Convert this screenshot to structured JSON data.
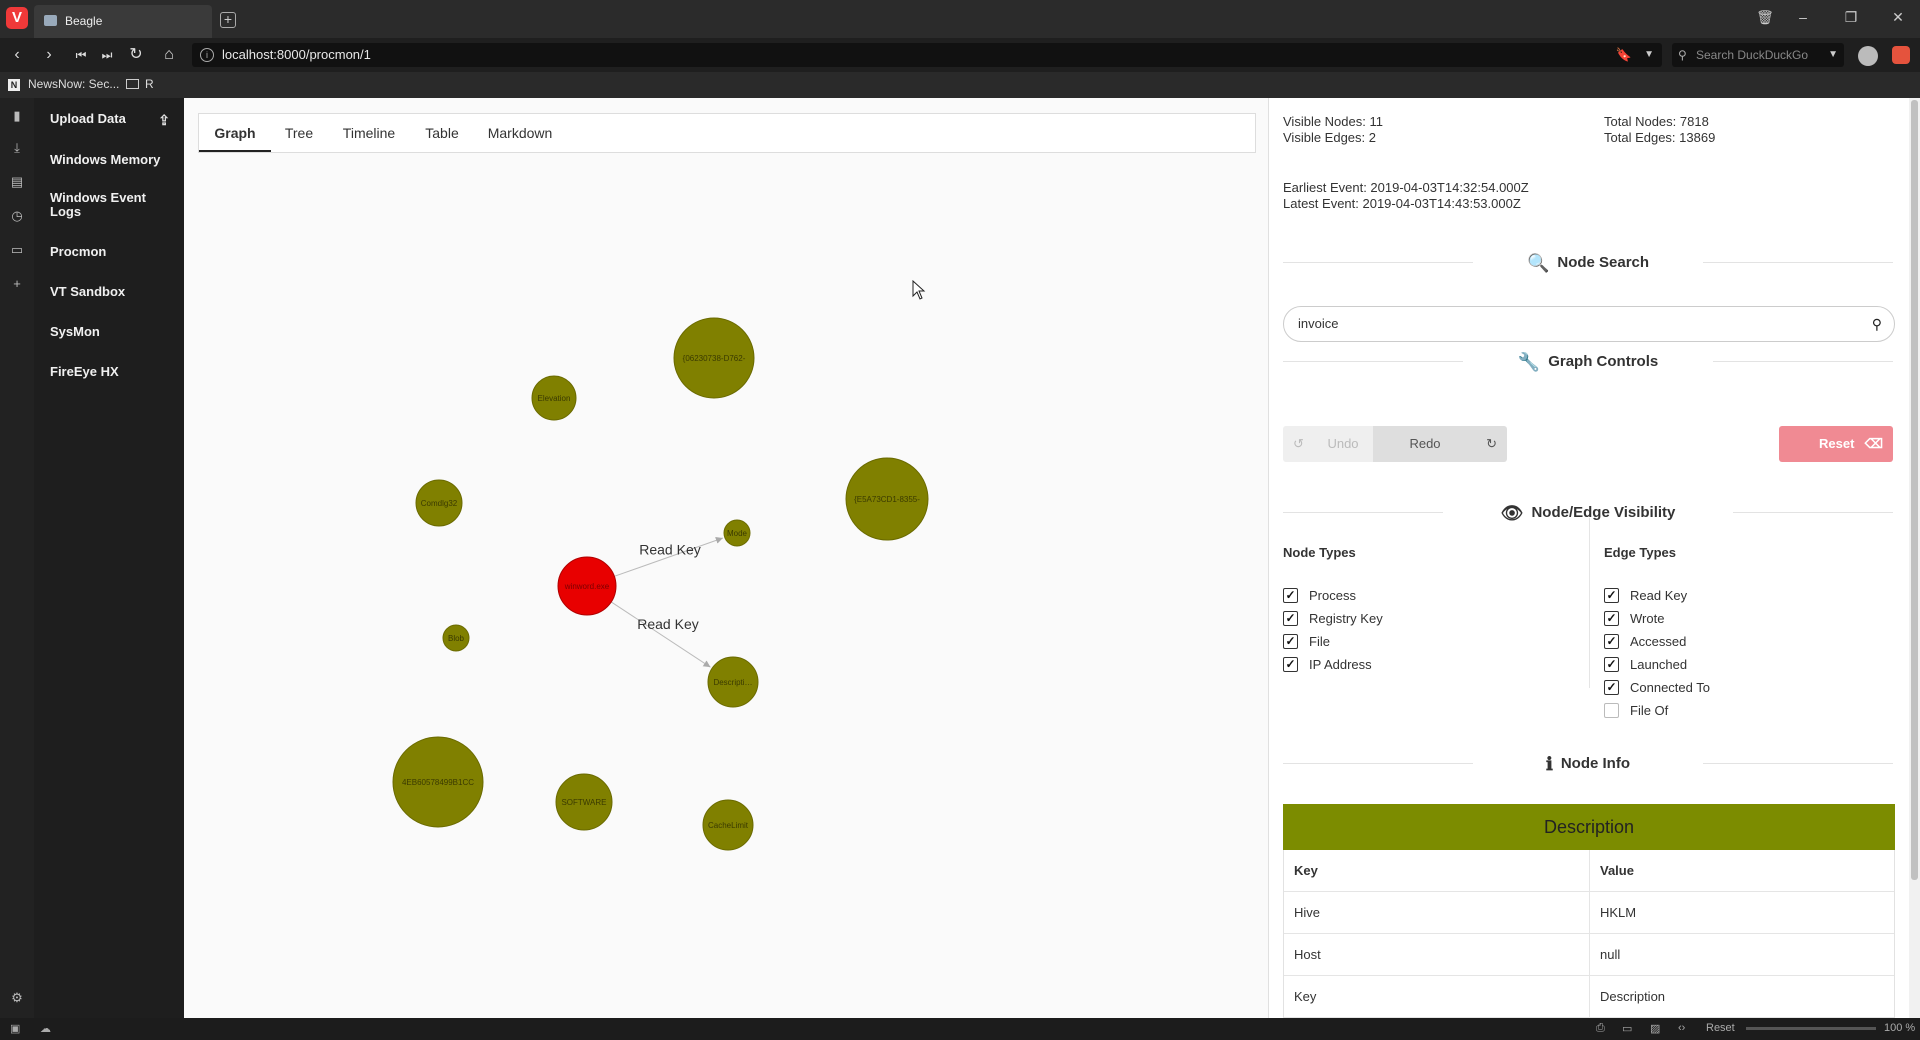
{
  "browser": {
    "tab_title": "Beagle",
    "url": "localhost:8000/procmon/1",
    "search_placeholder": "Search DuckDuckGo",
    "bookmarks": [
      "NewsNow: Sec...",
      "R"
    ],
    "status": {
      "reset_label": "Reset",
      "zoom": "100 %"
    }
  },
  "sidebar": {
    "items": [
      {
        "label": "Upload Data"
      },
      {
        "label": "Windows Memory"
      },
      {
        "label": "Windows Event Logs"
      },
      {
        "label": "Procmon"
      },
      {
        "label": "VT Sandbox"
      },
      {
        "label": "SysMon"
      },
      {
        "label": "FireEye HX"
      }
    ]
  },
  "tabs": [
    "Graph",
    "Tree",
    "Timeline",
    "Table",
    "Markdown"
  ],
  "active_tab": "Graph",
  "graph": {
    "node_color": "#808000",
    "active_node_color": "#e80000",
    "nodes": [
      {
        "id": "guid1",
        "label": "{06230738-D762-"
      },
      {
        "id": "elev",
        "label": "Elevation"
      },
      {
        "id": "guid2",
        "label": "{E5A73CD1-8355-"
      },
      {
        "id": "comdlg",
        "label": "Comdlg32"
      },
      {
        "id": "mode",
        "label": "Mode"
      },
      {
        "id": "proc",
        "label": "winword.exe"
      },
      {
        "id": "blob",
        "label": "Blob"
      },
      {
        "id": "desc",
        "label": "Description"
      },
      {
        "id": "hash",
        "label": "4EB60578499B1CC"
      },
      {
        "id": "software",
        "label": "SOFTWARE"
      },
      {
        "id": "cache",
        "label": "CacheLimit"
      }
    ],
    "edges": [
      {
        "from": "proc",
        "to": "mode",
        "label": "Read Key"
      },
      {
        "from": "proc",
        "to": "desc",
        "label": "Read Key"
      }
    ]
  },
  "stats": {
    "visible_nodes": "Visible Nodes: 11",
    "visible_edges": "Visible Edges: 2",
    "total_nodes": "Total Nodes: 7818",
    "total_edges": "Total Edges: 13869",
    "earliest": "Earliest Event: 2019-04-03T14:32:54.000Z",
    "latest": "Latest Event: 2019-04-03T14:43:53.000Z"
  },
  "node_search": {
    "title": "Node Search",
    "value": "invoice"
  },
  "graph_controls": {
    "title": "Graph Controls",
    "undo": "Undo",
    "redo": "Redo",
    "reset": "Reset"
  },
  "visibility": {
    "title": "Node/Edge Visibility",
    "node_types_title": "Node Types",
    "edge_types_title": "Edge Types",
    "node_types": [
      {
        "label": "Process",
        "checked": true
      },
      {
        "label": "Registry Key",
        "checked": true
      },
      {
        "label": "File",
        "checked": true
      },
      {
        "label": "IP Address",
        "checked": true
      }
    ],
    "edge_types": [
      {
        "label": "Read Key",
        "checked": true
      },
      {
        "label": "Wrote",
        "checked": true
      },
      {
        "label": "Accessed",
        "checked": true
      },
      {
        "label": "Launched",
        "checked": true
      },
      {
        "label": "Connected To",
        "checked": true
      },
      {
        "label": "File Of",
        "checked": false
      }
    ]
  },
  "node_info": {
    "title": "Node Info",
    "node_name": "Description",
    "header_color": "#7c8c00",
    "columns": [
      "Key",
      "Value"
    ],
    "rows": [
      {
        "key": "Hive",
        "value": "HKLM"
      },
      {
        "key": "Host",
        "value": "null"
      },
      {
        "key": "Key",
        "value": "Description"
      }
    ]
  }
}
